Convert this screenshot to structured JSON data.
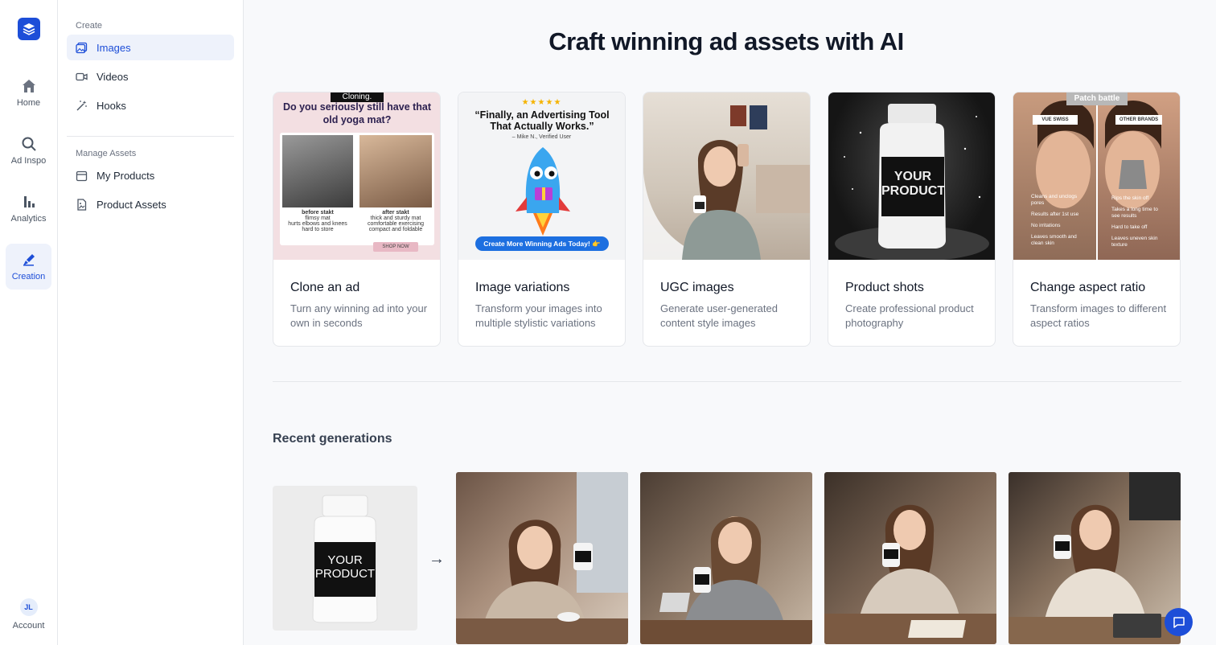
{
  "colors": {
    "accent": "#1d4ed8",
    "accent_bg": "#eef2fb",
    "page_bg": "#f8f9fb"
  },
  "rail": {
    "items": [
      {
        "label": "Home",
        "icon": "home-icon"
      },
      {
        "label": "Ad Inspo",
        "icon": "search-icon"
      },
      {
        "label": "Analytics",
        "icon": "bar-chart-icon"
      },
      {
        "label": "Creation",
        "icon": "brush-icon",
        "active": true
      }
    ],
    "account": {
      "initials": "JL",
      "label": "Account"
    }
  },
  "sidebar": {
    "create_heading": "Create",
    "create_items": [
      {
        "label": "Images",
        "icon": "image-icon",
        "active": true
      },
      {
        "label": "Videos",
        "icon": "video-icon"
      },
      {
        "label": "Hooks",
        "icon": "magic-wand-icon"
      }
    ],
    "manage_heading": "Manage Assets",
    "manage_items": [
      {
        "label": "My Products",
        "icon": "box-icon"
      },
      {
        "label": "Product Assets",
        "icon": "file-image-icon"
      }
    ]
  },
  "main": {
    "headline": "Craft winning ad assets with AI",
    "cards": [
      {
        "title": "Clone an ad",
        "description": "Turn any winning ad into your own in seconds",
        "thumb": {
          "badge": "Cloning.",
          "heading": "Do you seriously still have that old yoga mat?",
          "left_caption": "before stakt",
          "left_points": [
            "flimsy mat",
            "hurts elbows and knees",
            "hard to store"
          ],
          "right_caption": "after stakt",
          "right_points": [
            "thick and sturdy mat",
            "comfortable exercising",
            "compact and foldable"
          ],
          "cta": "SHOP NOW"
        }
      },
      {
        "title": "Image variations",
        "description": "Transform your images into multiple stylistic variations",
        "thumb": {
          "stars": "★★★★★",
          "quote": "“Finally, an Advertising Tool That Actually Works.”",
          "attribution": "– Mike N., Verified User",
          "cta": "Create More Winning Ads Today! 👉"
        }
      },
      {
        "title": "UGC images",
        "description": "Generate user-generated content style images"
      },
      {
        "title": "Product shots",
        "description": "Create professional product photography",
        "thumb": {
          "label": "YOUR PRODUCT"
        }
      },
      {
        "title": "Change aspect ratio",
        "description": "Transform images to different aspect ratios",
        "thumb": {
          "badge": "Patch battle",
          "left_brand": "VUE SWISS",
          "right_brand": "OTHER BRANDS",
          "left_points": [
            "Cleans and unclogs pores",
            "Results after 1st use",
            "No irritations",
            "Leaves smooth and clean skin"
          ],
          "right_points": [
            "Rips the skin off",
            "Takes a long time to see results",
            "Hard to take off",
            "Leaves uneven skin texture"
          ]
        }
      }
    ],
    "recent": {
      "title": "Recent generations",
      "source_label": "YOUR PRODUCT",
      "arrow": "→"
    }
  }
}
